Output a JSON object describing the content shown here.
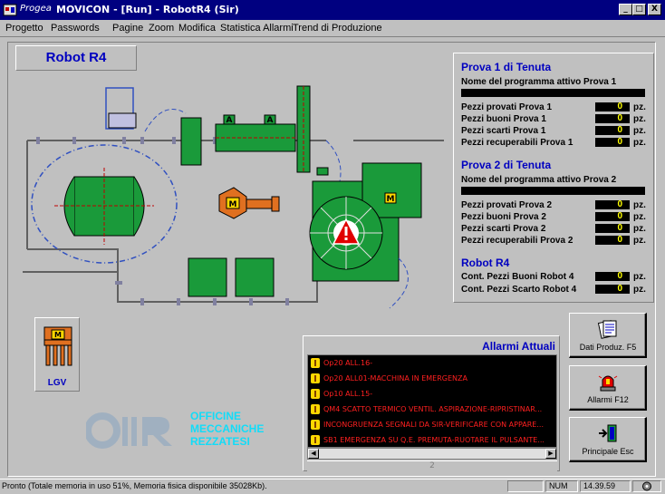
{
  "window": {
    "brand": "Progea",
    "title": "MOVICON - [Run] - RobotR4 (Sir)",
    "min_label": "_",
    "max_label": "□",
    "close_label": "X"
  },
  "menu": [
    "Progetto",
    "Passwords",
    "Pagine",
    "Zoom",
    "Modifica",
    "Statistica Allarmi",
    "Trend di Produzione"
  ],
  "page_title": "Robot R4",
  "plant": {
    "machine_labels": [
      "A",
      "A",
      "M",
      "M",
      "M"
    ],
    "lgv_label": "LGV"
  },
  "panel": {
    "prova1": {
      "heading": "Prova 1 di Tenuta",
      "program_label": "Nome del programma attivo Prova 1",
      "rows": [
        {
          "label": "Pezzi provati Prova 1",
          "value": "0",
          "unit": "pz."
        },
        {
          "label": "Pezzi buoni Prova 1",
          "value": "0",
          "unit": "pz."
        },
        {
          "label": "Pezzi scarti Prova 1",
          "value": "0",
          "unit": "pz."
        },
        {
          "label": "Pezzi recuperabili Prova 1",
          "value": "0",
          "unit": "pz."
        }
      ]
    },
    "prova2": {
      "heading": "Prova 2 di Tenuta",
      "program_label": "Nome del programma attivo Prova 2",
      "rows": [
        {
          "label": "Pezzi provati Prova 2",
          "value": "0",
          "unit": "pz."
        },
        {
          "label": "Pezzi buoni Prova 2",
          "value": "0",
          "unit": "pz."
        },
        {
          "label": "Pezzi scarti Prova 2",
          "value": "0",
          "unit": "pz."
        },
        {
          "label": "Pezzi recuperabili Prova 2",
          "value": "0",
          "unit": "pz."
        }
      ]
    },
    "robot": {
      "heading": "Robot R4",
      "rows": [
        {
          "label": "Cont. Pezzi Buoni Robot 4",
          "value": "0",
          "unit": "pz."
        },
        {
          "label": "Cont. Pezzi Scarto Robot 4",
          "value": "0",
          "unit": "pz."
        }
      ]
    }
  },
  "alarms": {
    "title": "Allarmi Attuali",
    "items": [
      "Op20 ALL.16-",
      "Op20 ALL01-MACCHINA IN EMERGENZA",
      "Op10 ALL.15-",
      "QM4 SCATTO TERMICO VENTIL. ASPIRAZIONE-RIPRISTINAR...",
      "INCONGRUENZA SEGNALI DA SIR-VERIFICARE CON APPARE...",
      "SB1 EMERGENZA SU Q.E. PREMUTA-RUOTARE IL PULSANTE..."
    ],
    "count": "2"
  },
  "buttons": {
    "dati": "Dati Produz. F5",
    "allarmi": "Allarmi F12",
    "principale": "Principale Esc"
  },
  "logo": {
    "mark": "OIIR",
    "line1": "OFFICINE",
    "line2": "MECCANICHE",
    "line3": "REZZATESI"
  },
  "status": {
    "text": "Pronto (Totale memoria in uso 51%, Memoria fisica disponibile 35028Kb).",
    "num": "NUM",
    "time": "14.39.59"
  },
  "colors": {
    "green": "#1a9a3a",
    "accent_blue": "#0000c0",
    "alarm_red": "#ff2020",
    "title_bar": "#000080"
  }
}
